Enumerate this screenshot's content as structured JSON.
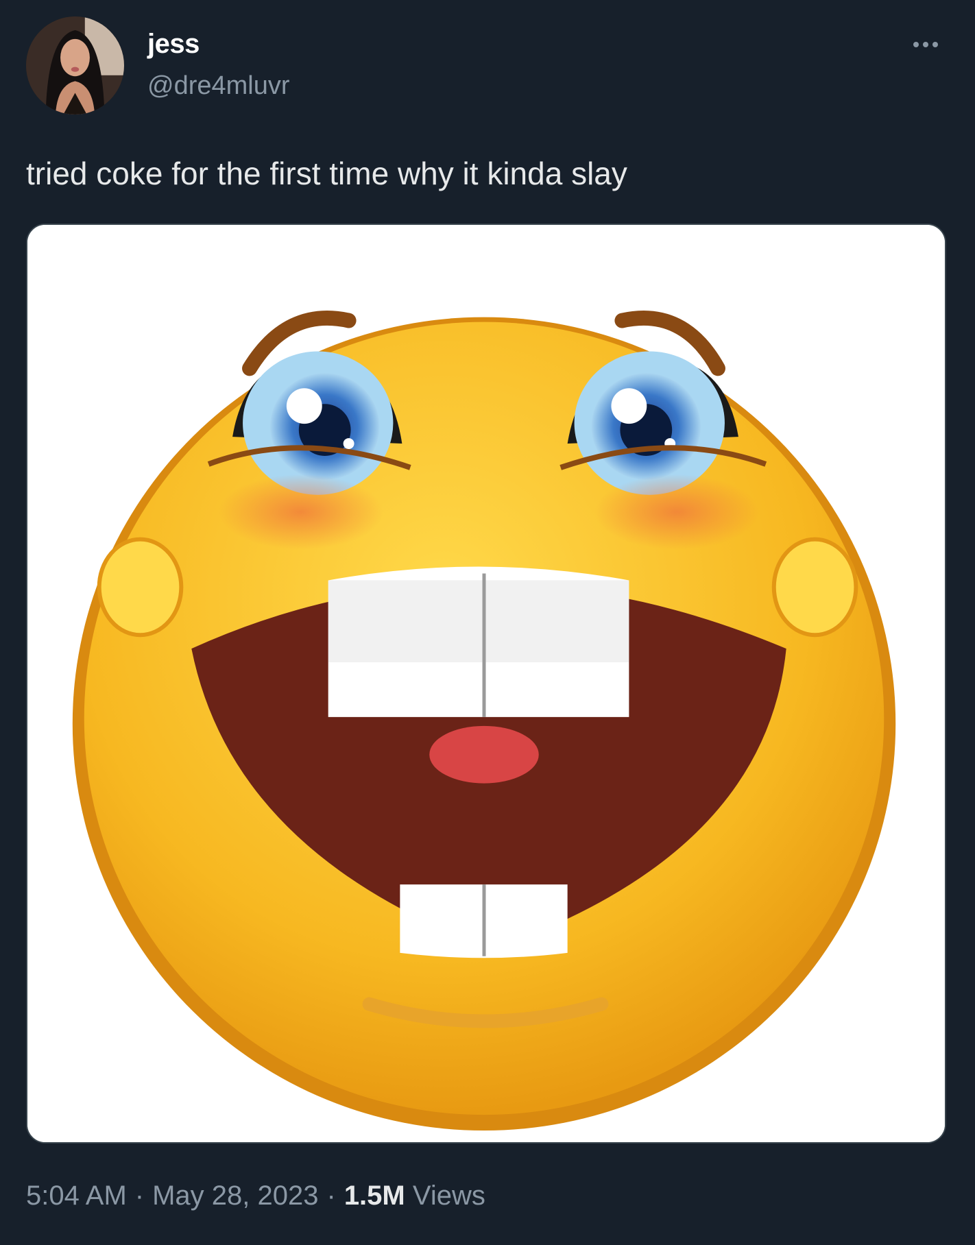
{
  "user": {
    "display_name": "jess",
    "handle": "@dre4mluvr"
  },
  "tweet": {
    "text": "tried coke for the first time why it kinda slay",
    "media_description_icon": "grinning-emoji-image"
  },
  "meta": {
    "time": "5:04 AM",
    "date": "May 28, 2023",
    "views_count": "1.5M",
    "views_label": "Views",
    "separator": "·"
  },
  "colors": {
    "background": "#17202b",
    "secondary_text": "#8b98a5",
    "primary_text": "#e7e9ea"
  }
}
